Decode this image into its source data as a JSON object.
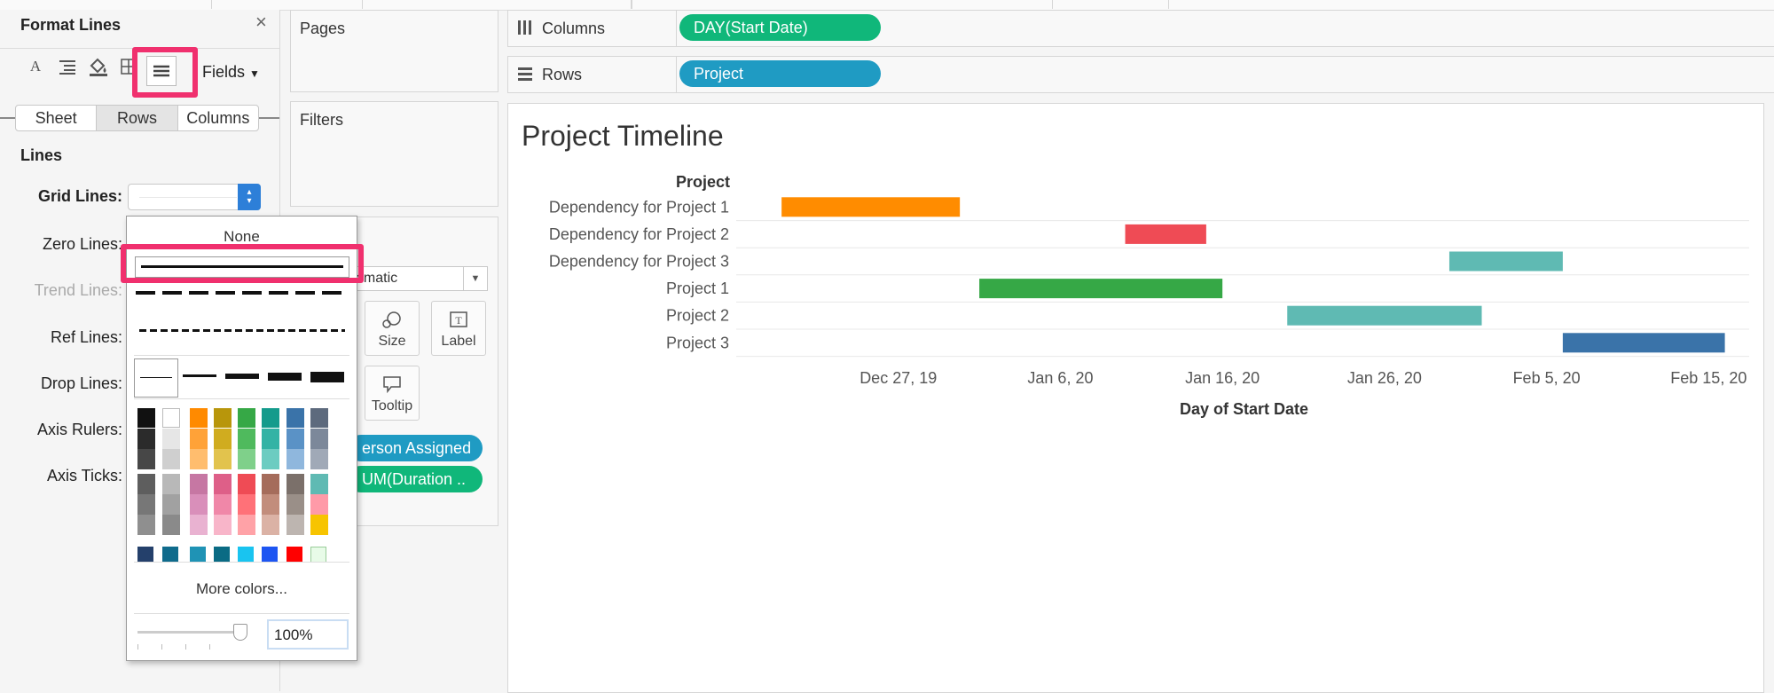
{
  "format_pane": {
    "title": "Format Lines",
    "toolbar": {
      "icons": [
        "font-icon",
        "alignment-icon",
        "shading-icon",
        "borders-icon",
        "lines-icon"
      ],
      "fields_label": "Fields"
    },
    "tabs": [
      {
        "label": "Sheet",
        "selected": false
      },
      {
        "label": "Rows",
        "selected": true
      },
      {
        "label": "Columns",
        "selected": false
      }
    ],
    "section_title": "Lines",
    "rows": {
      "grid": "Grid Lines:",
      "zero": "Zero Lines:",
      "trend": "Trend Lines:",
      "ref": "Ref Lines:",
      "drop": "Drop Lines:",
      "axis_rulers": "Axis Rulers:",
      "axis_ticks": "Axis Ticks:"
    }
  },
  "line_dropdown": {
    "none_label": "None",
    "more_colors": "More colors...",
    "opacity_value": "100%",
    "accent": "#f0306e"
  },
  "cards": {
    "pages": "Pages",
    "filters": "Filters",
    "marks_type": "omatic",
    "size_label": "Size",
    "label_label": "Label",
    "tooltip_label": "Tooltip",
    "pill_person": "erson Assigned",
    "pill_duration": "UM(Duration .."
  },
  "shelves": {
    "columns_label": "Columns",
    "rows_label": "Rows",
    "columns_pill": "DAY(Start Date)",
    "rows_pill": "Project"
  },
  "chart_data": {
    "type": "bar",
    "subtype": "gantt",
    "title": "Project Timeline",
    "row_header": "Project",
    "xlabel": "Day of Start Date",
    "x_ticks": [
      "Dec 27, 19",
      "Jan 6, 20",
      "Jan 16, 20",
      "Jan 26, 20",
      "Feb 5, 20",
      "Feb 15, 20"
    ],
    "x_tick_days": [
      0,
      10,
      20,
      30,
      40,
      50
    ],
    "x_range_days": [
      -10,
      52.5
    ],
    "tasks": [
      {
        "name": "Dependency for Project 1",
        "start": -7.2,
        "duration": 11,
        "color": "#ff8c00"
      },
      {
        "name": "Dependency for Project 2",
        "start": 14,
        "duration": 5,
        "color": "#ef4b55"
      },
      {
        "name": "Dependency for Project 3",
        "start": 34,
        "duration": 7,
        "color": "#5fbab3"
      },
      {
        "name": "Project 1",
        "start": 5,
        "duration": 15,
        "color": "#36a846"
      },
      {
        "name": "Project 2",
        "start": 24,
        "duration": 12,
        "color": "#5fbab3"
      },
      {
        "name": "Project 3",
        "start": 41,
        "duration": 10,
        "color": "#3a73a9"
      }
    ]
  }
}
